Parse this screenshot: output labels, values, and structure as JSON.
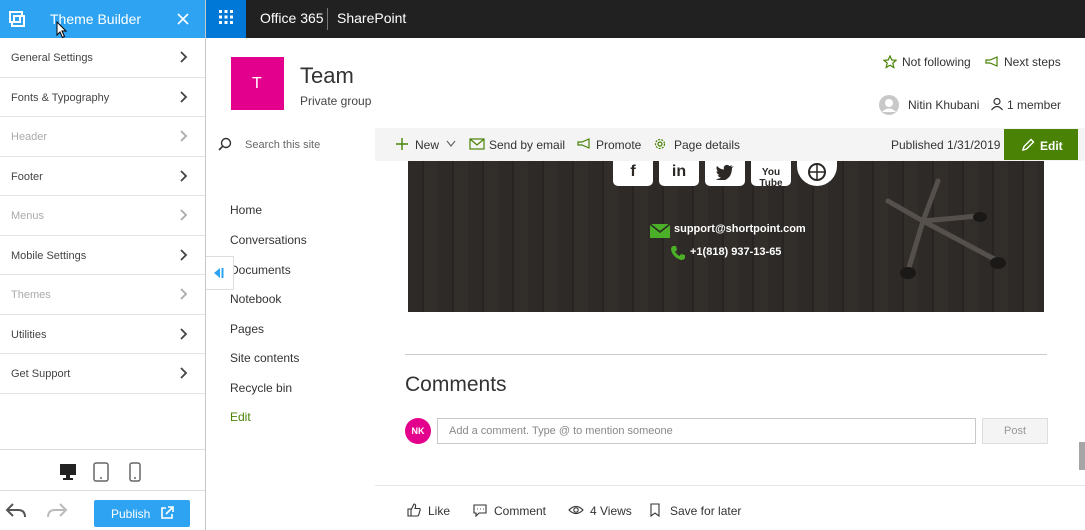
{
  "theme_builder": {
    "title": "Theme Builder",
    "items": [
      {
        "label": "General Settings",
        "enabled": true
      },
      {
        "label": "Fonts & Typography",
        "enabled": true
      },
      {
        "label": "Header",
        "enabled": false
      },
      {
        "label": "Footer",
        "enabled": true
      },
      {
        "label": "Menus",
        "enabled": false
      },
      {
        "label": "Mobile Settings",
        "enabled": true
      },
      {
        "label": "Themes",
        "enabled": false
      },
      {
        "label": "Utilities",
        "enabled": true
      },
      {
        "label": "Get Support",
        "enabled": true
      }
    ],
    "publish_label": "Publish",
    "accent_color": "#2ea3f2"
  },
  "suite_bar": {
    "app_name": "Office 365",
    "product_name": "SharePoint",
    "waffle_color": "#0078d7"
  },
  "site": {
    "logo_letter": "T",
    "logo_color": "#e3008c",
    "title": "Team",
    "subtitle": "Private group",
    "not_following": "Not following",
    "next_steps": "Next steps",
    "user_name": "Nitin Khubani",
    "members": "1 member"
  },
  "command_bar": {
    "new_label": "New",
    "send_by_email": "Send by email",
    "promote": "Promote",
    "page_details": "Page details",
    "published": "Published 1/31/2019",
    "edit_label": "Edit",
    "edit_color": "#498205"
  },
  "nav": {
    "search_placeholder": "Search this site",
    "items": [
      "Home",
      "Conversations",
      "Documents",
      "Notebook",
      "Pages",
      "Site contents",
      "Recycle bin"
    ],
    "edit_label": "Edit"
  },
  "footer_banner": {
    "social": [
      "f",
      "in",
      "twitter",
      "You Tube",
      "website"
    ],
    "email": "support@shortpoint.com",
    "phone": "+1(818) 937-13-65",
    "icon_color": "#4caf28"
  },
  "comments": {
    "heading": "Comments",
    "avatar_initials": "NK",
    "input_placeholder": "Add a comment. Type @ to mention someone",
    "post_label": "Post"
  },
  "bottom_bar": {
    "like": "Like",
    "comment": "Comment",
    "views": "4 Views",
    "save_for_later": "Save for later"
  }
}
